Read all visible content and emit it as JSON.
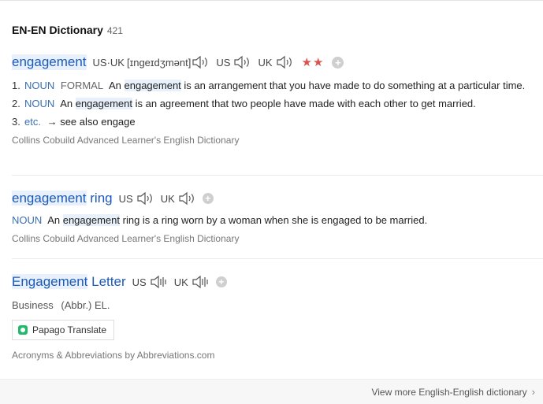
{
  "header": {
    "title": "EN-EN Dictionary",
    "count": "421"
  },
  "entries": [
    {
      "headword": "engagement",
      "pron_label_1": "US·UK",
      "ipa": "[ɪnɡeɪdʒmənt]",
      "pron_label_2": "US",
      "pron_label_3": "UK",
      "stars": "★★",
      "definitions": [
        {
          "num": "1.",
          "pos": "NOUN",
          "register": "FORMAL",
          "pre": "An",
          "hl": "engagement",
          "post": "is an arrangement that you have made to do something at a particular time."
        },
        {
          "num": "2.",
          "pos": "NOUN",
          "pre": "An",
          "hl": "engagement",
          "post": "is an agreement that two people have made with each other to get married."
        },
        {
          "num": "3.",
          "pos": "etc.",
          "text": "→ see also engage"
        }
      ],
      "source": "Collins Cobuild Advanced Learner's English Dictionary"
    },
    {
      "headword_hl": "engagement",
      "headword_rest": "ring",
      "pron_label_1": "US",
      "pron_label_2": "UK",
      "definition": {
        "pos": "NOUN",
        "pre": "An",
        "hl": "engagement",
        "post": "ring is a ring worn by a woman when she is engaged to be married."
      },
      "source": "Collins Cobuild Advanced Learner's English Dictionary"
    },
    {
      "headword_hl": "Engagement",
      "headword_rest": "Letter",
      "pron_label_1": "US",
      "pron_label_2": "UK",
      "category": "Business",
      "abbr": "(Abbr.) EL.",
      "translate_button": "Papago Translate",
      "source": "Acronyms & Abbreviations by Abbreviations.com"
    }
  ],
  "footer": {
    "link": "View more English-English dictionary"
  },
  "colors": {
    "link": "#1c5ab8",
    "highlight": "#e8f1fb",
    "stars": "#d9534f",
    "papago": "#1fba6a"
  },
  "icons": [
    "speaker-icon",
    "plus-icon",
    "papago-icon",
    "chevron-right-icon"
  ]
}
